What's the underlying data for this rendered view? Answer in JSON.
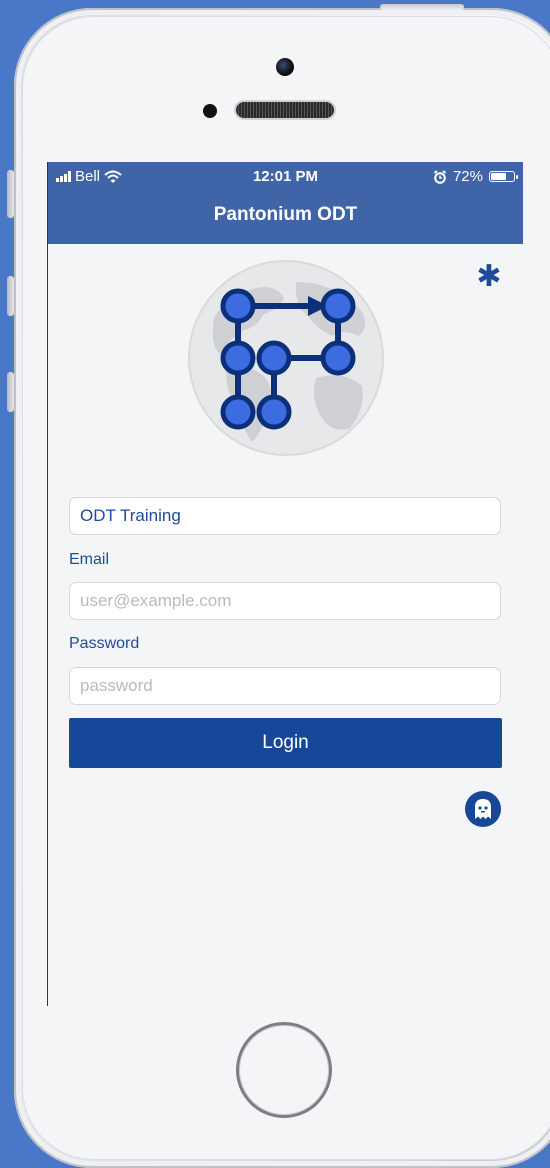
{
  "status_bar": {
    "carrier": "Bell",
    "time": "12:01 PM",
    "battery": "72%",
    "battery_level": 0.72
  },
  "header": {
    "title": "Pantonium ODT"
  },
  "settings_icon": "asterisk-icon",
  "logo": {
    "name": "pantonium-globe-logo"
  },
  "form": {
    "account": {
      "value": "ODT Training"
    },
    "email": {
      "label": "Email",
      "placeholder": "user@example.com",
      "value": ""
    },
    "password": {
      "label": "Password",
      "placeholder": "password",
      "value": ""
    },
    "login_label": "Login"
  },
  "privacy_icon": "ghost-icon",
  "colors": {
    "header": "#3f65a8",
    "accent": "#174799",
    "label_text": "#1d4b9c",
    "backdrop": "#4a78c9"
  }
}
